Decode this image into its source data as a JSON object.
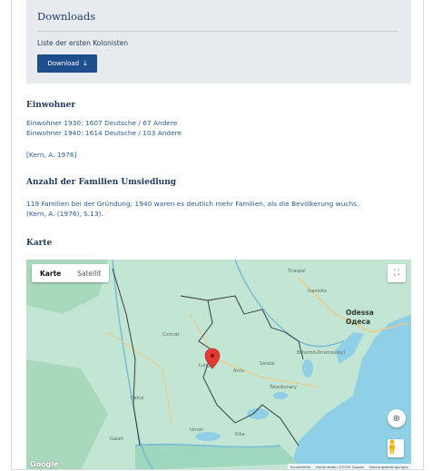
{
  "downloads": {
    "title": "Downloads",
    "subtitle": "Liste der ersten Kolonisten",
    "button_label": "Download",
    "button_icon": "download-icon"
  },
  "residents": {
    "heading": "Einwohner",
    "line1": "Einwohner 1930: 1607 Deutsche / 67 Andere",
    "line2": "Einwohner 1940: 1614 Deutsche / 103 Andere",
    "source": "[Kern, A. 1976]"
  },
  "families": {
    "heading": "Anzahl der Familien Umsiedlung",
    "text1": "119 Familien bei der Gründung; 1940 waren es deutlich mehr Familien, als die Bevölkerung wuchs.",
    "text2": "(Kern, A. (1976), S.13)."
  },
  "map": {
    "heading": "Karte",
    "tabs": [
      "Karte",
      "Satellit"
    ],
    "active_tab": "Karte",
    "places": {
      "tiraspol": "Tiraspol",
      "odessa": "Odessa",
      "odesa_cyr": "Одеса",
      "lunga": "Lunga",
      "arcis": "Arcis",
      "sarata": "Sarata",
      "tatarbunary": "Tatarbunary",
      "comrat": "Comrat",
      "cahul": "Cahul",
      "kilia": "Kilia",
      "galati": "Galati",
      "izmail": "Izmail",
      "bilhorod": "Bilhorod-Dnistrovskyi",
      "ivanivka": "Ivanivka"
    },
    "attribution": {
      "shortcuts": "Kurzbefehle",
      "data": "Kartendaten ©2025 Google",
      "terms": "Nutzungsbedingungen"
    },
    "logo": "Google",
    "colors": {
      "land": "#bde3cf",
      "water": "#8fd0e6",
      "border": "#2e2e2e",
      "marker": "#e53935"
    }
  }
}
